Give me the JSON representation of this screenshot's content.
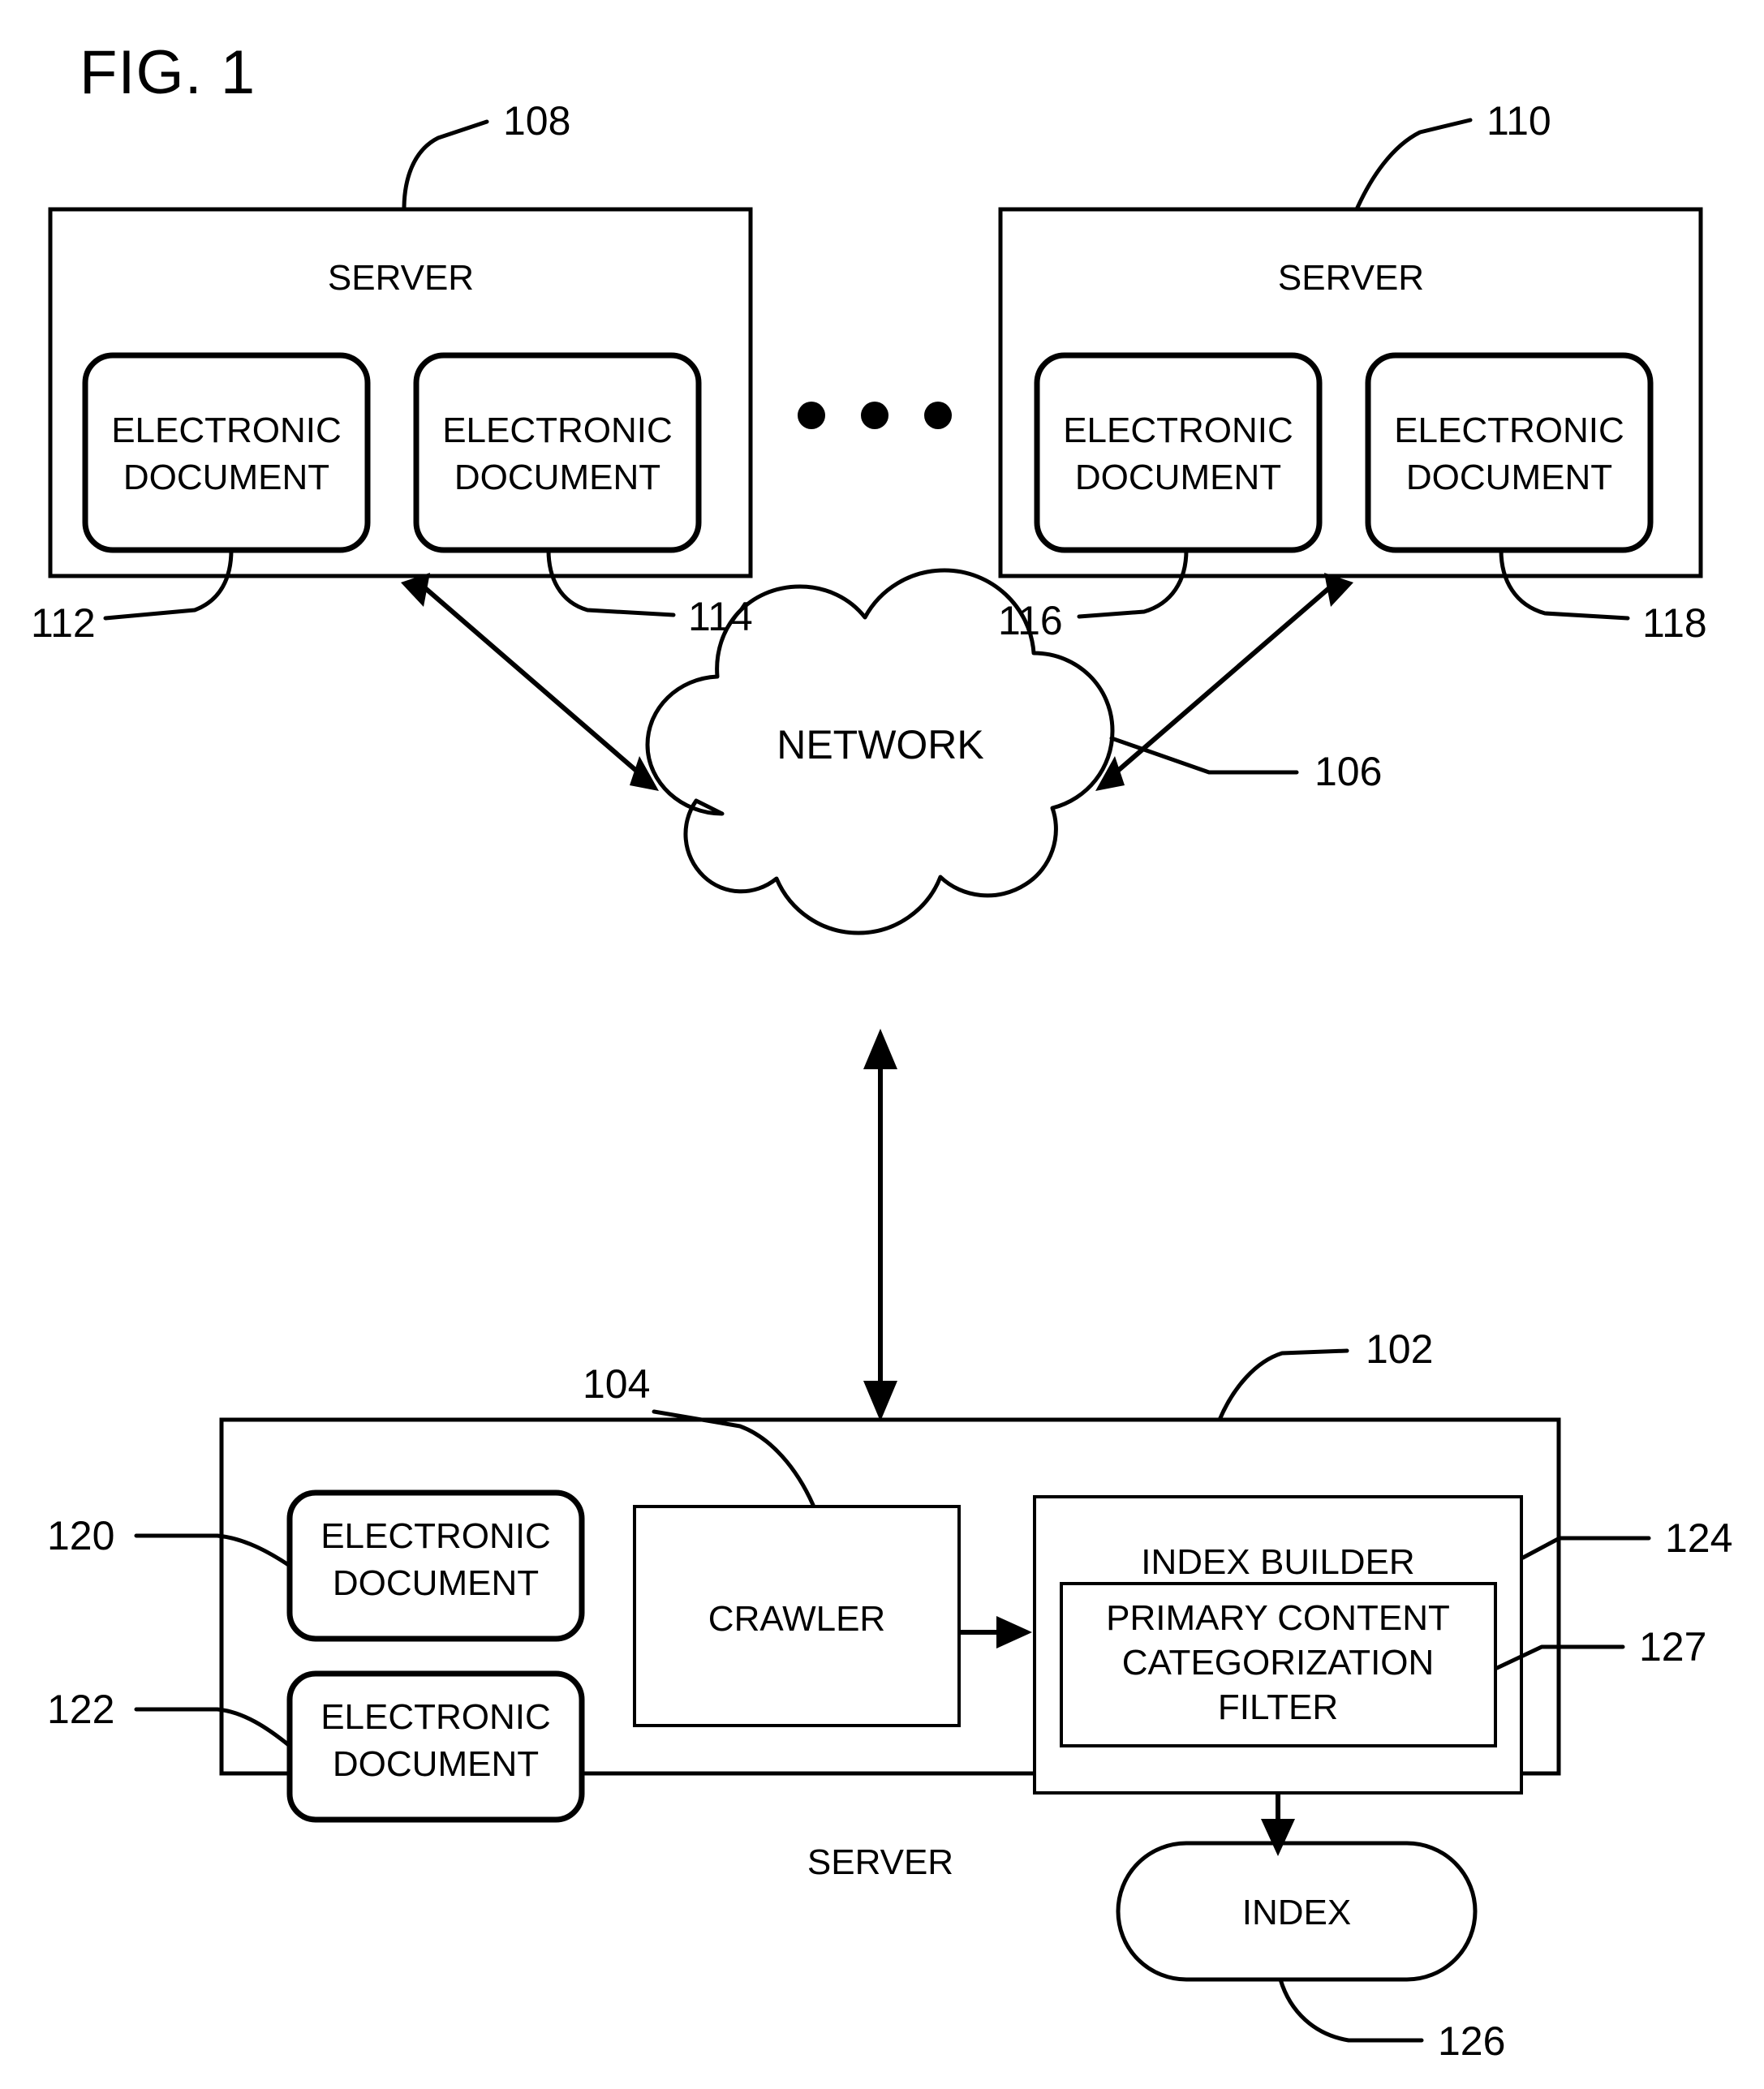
{
  "figure": {
    "title": "FIG. 1"
  },
  "servers": {
    "top_left": {
      "label": "SERVER",
      "ref": "108",
      "documents": [
        {
          "line1": "ELECTRONIC",
          "line2": "DOCUMENT",
          "ref": "112"
        },
        {
          "line1": "ELECTRONIC",
          "line2": "DOCUMENT",
          "ref": "114"
        }
      ]
    },
    "top_right": {
      "label": "SERVER",
      "ref": "110",
      "documents": [
        {
          "line1": "ELECTRONIC",
          "line2": "DOCUMENT",
          "ref": "116"
        },
        {
          "line1": "ELECTRONIC",
          "line2": "DOCUMENT",
          "ref": "118"
        }
      ]
    },
    "bottom": {
      "label": "SERVER",
      "ref": "102",
      "documents": [
        {
          "line1": "ELECTRONIC",
          "line2": "DOCUMENT",
          "ref": "120"
        },
        {
          "line1": "ELECTRONIC",
          "line2": "DOCUMENT",
          "ref": "122"
        }
      ],
      "crawler": {
        "label": "CRAWLER",
        "ref": "104"
      },
      "index_builder": {
        "label": "INDEX BUILDER",
        "ref": "124",
        "filter": {
          "line1": "PRIMARY CONTENT",
          "line2": "CATEGORIZATION",
          "line3": "FILTER",
          "ref": "127"
        }
      },
      "index": {
        "label": "INDEX",
        "ref": "126"
      }
    }
  },
  "network": {
    "label": "NETWORK",
    "ref": "106"
  },
  "ellipsis": {
    "dots": 3
  },
  "colors": {
    "stroke": "#000000",
    "fill": "#ffffff"
  }
}
